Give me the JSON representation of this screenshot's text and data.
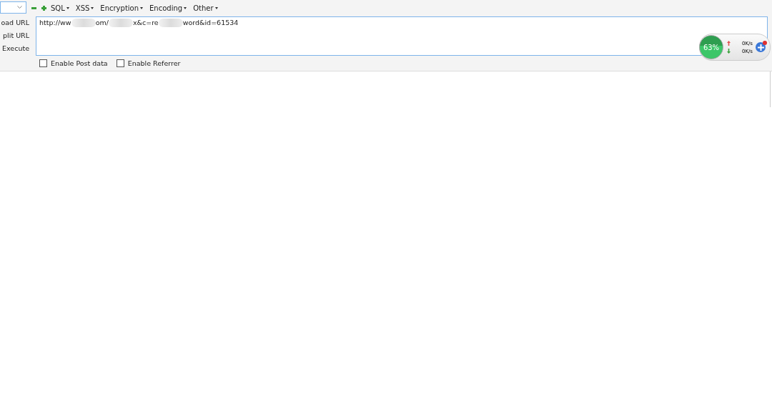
{
  "toolbar": {
    "menus": [
      {
        "label": "SQL"
      },
      {
        "label": "XSS"
      },
      {
        "label": "Encryption"
      },
      {
        "label": "Encoding"
      },
      {
        "label": "Other"
      }
    ]
  },
  "actions": [
    {
      "label": "oad URL"
    },
    {
      "label": "plit URL"
    },
    {
      "label": "Execute"
    }
  ],
  "url_field": {
    "parts": [
      {
        "kind": "text",
        "text": "http://ww"
      },
      {
        "kind": "blur"
      },
      {
        "kind": "text",
        "text": "om/"
      },
      {
        "kind": "blur"
      },
      {
        "kind": "text",
        "text": "x&c=re"
      },
      {
        "kind": "blur"
      },
      {
        "kind": "text",
        "text": "word&id=61534"
      }
    ]
  },
  "options": [
    {
      "label": "Enable Post data",
      "checked": false
    },
    {
      "label": "Enable Referrer",
      "checked": false
    }
  ],
  "speed_widget": {
    "percent": "63%",
    "upload": "0K/s",
    "download": "0K/s"
  }
}
